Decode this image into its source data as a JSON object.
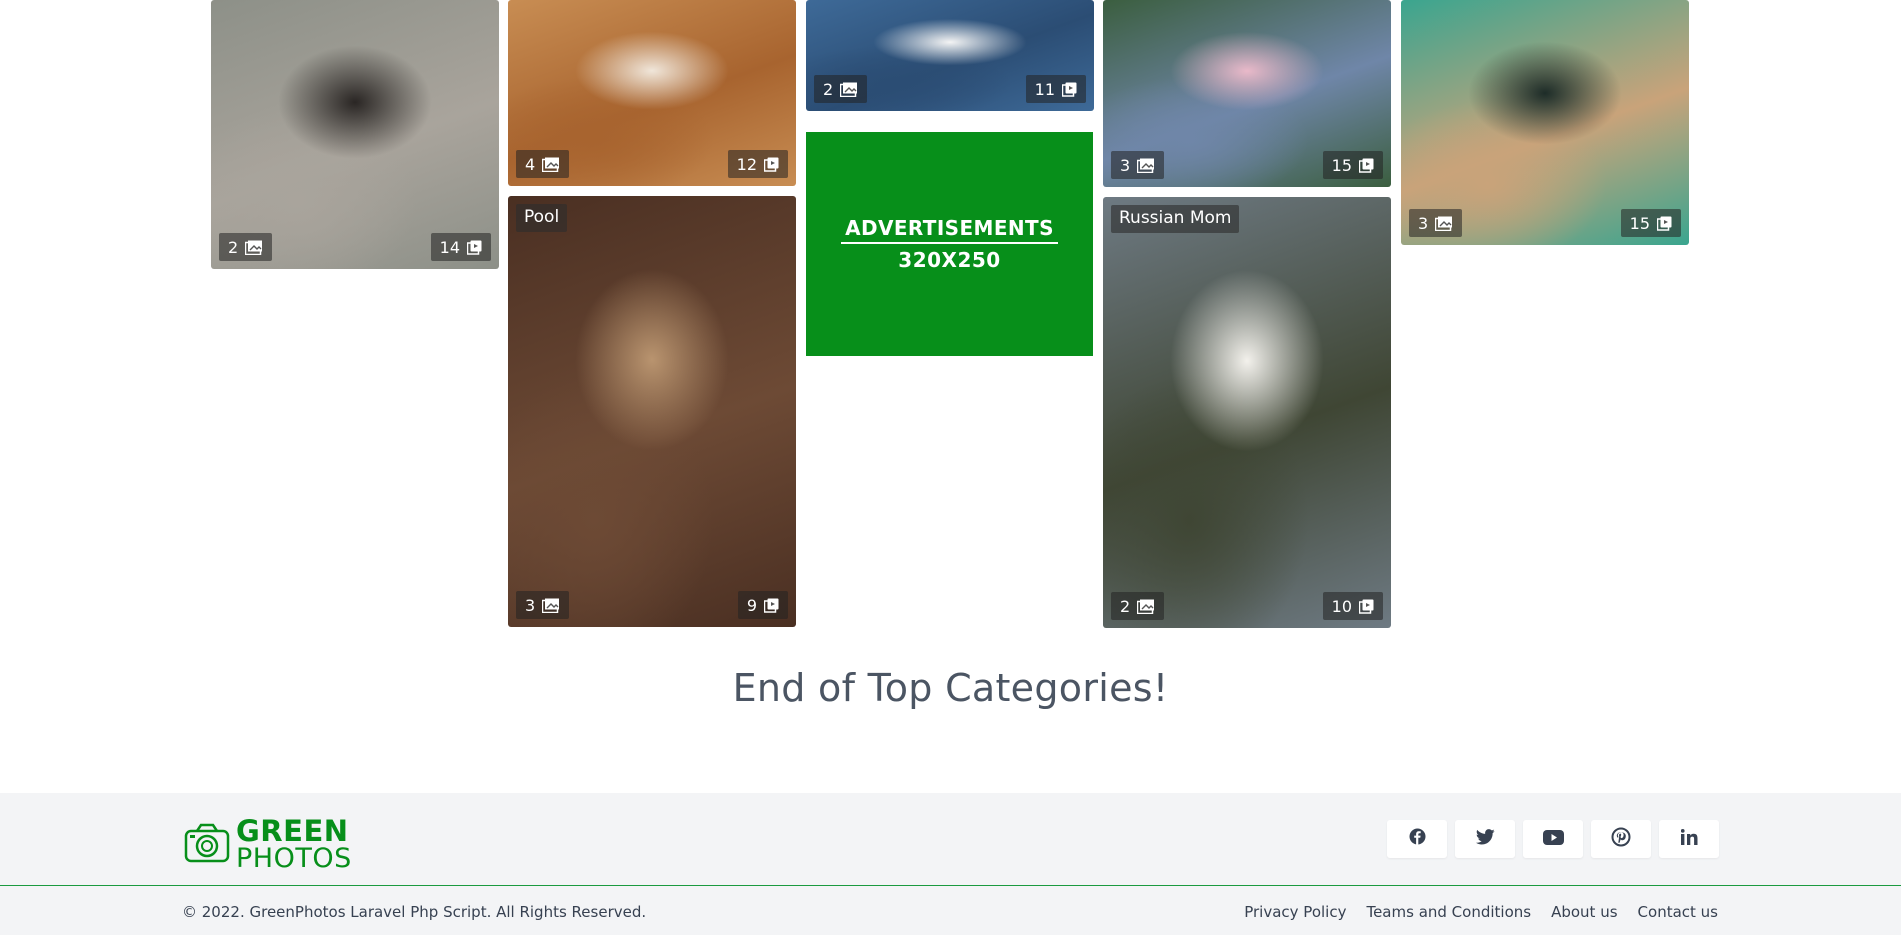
{
  "cards": [
    {
      "name": "",
      "photo_count": "2",
      "view_count": "14",
      "palette": [
        "#8d9088",
        "#2a2624",
        "#a9a49c"
      ]
    },
    {
      "name": "",
      "photo_count": "4",
      "view_count": "12",
      "palette": [
        "#c88d53",
        "#f0e6da",
        "#a8642f"
      ]
    },
    {
      "name": "",
      "photo_count": "2",
      "view_count": "11",
      "palette": [
        "#3e6a98",
        "#f4f4f4",
        "#2b4d74"
      ]
    },
    {
      "name": "",
      "photo_count": "3",
      "view_count": "15",
      "palette": [
        "#3b5e3f",
        "#e9b9c9",
        "#6f86a8"
      ]
    },
    {
      "name": "",
      "photo_count": "3",
      "view_count": "15",
      "palette": [
        "#3aa58f",
        "#1d2c28",
        "#c9a37a"
      ]
    },
    {
      "name": "Pool",
      "photo_count": "3",
      "view_count": "9",
      "palette": [
        "#4a2f22",
        "#b9946f",
        "#6d4a35"
      ]
    },
    {
      "name": "Russian Mom",
      "photo_count": "2",
      "view_count": "10",
      "palette": [
        "#6e7a83",
        "#f3f1ec",
        "#3f4634"
      ]
    }
  ],
  "advertisement": {
    "line1": "ADVERTISEMENTS",
    "line2": "320X250"
  },
  "section_end_text": "End of Top Categories!",
  "footer": {
    "logo": {
      "line1": "GREEN",
      "line2": "PHOTOS"
    },
    "social_icons": [
      "facebook-icon",
      "twitter-icon",
      "youtube-icon",
      "pinterest-icon",
      "linkedin-icon"
    ],
    "copyright": "© 2022. GreenPhotos Laravel Php Script. All Rights Reserved.",
    "links": [
      "Privacy Policy",
      "Teams and Conditions",
      "About us",
      "Contact us"
    ]
  },
  "colors": {
    "brand_green": "#078f1a",
    "footer_bg": "#f3f4f6",
    "text_dark": "#4b5563"
  }
}
